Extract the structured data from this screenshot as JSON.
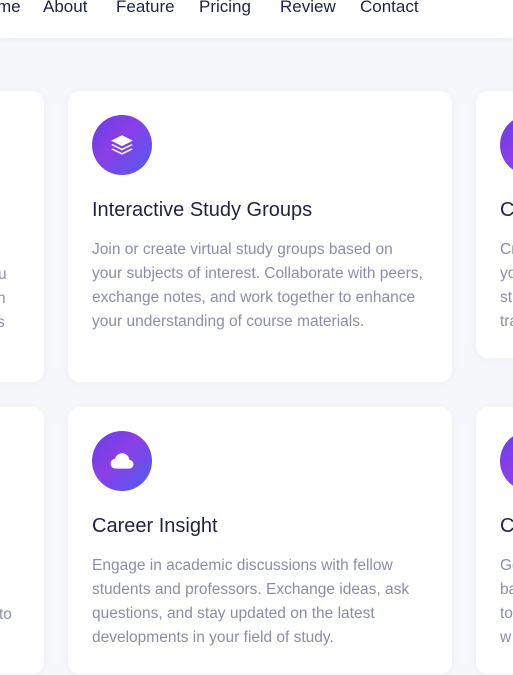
{
  "nav": {
    "items": [
      "me",
      "About",
      "Feature",
      "Pricing",
      "Review",
      "Contact"
    ]
  },
  "colors": {
    "background": "#f6f7fb",
    "card": "#ffffff",
    "title": "#1f2340",
    "body_text": "#8a8fa3",
    "icon_gradient_start": "#6a3de8",
    "icon_gradient_end": "#4a5ef0"
  },
  "cards": {
    "study_groups": {
      "icon": "layers-icon",
      "title": "Interactive Study Groups",
      "description": "Join or create virtual study groups based on your subjects of interest. Collaborate with peers, exchange notes, and work together to enhance your understanding of course materials."
    },
    "career_insight": {
      "icon": "cloud-icon",
      "title": "Career Insight",
      "description": "Engage in academic discussions with fellow students and professors. Exchange ideas, ask questions, and stay updated on the latest developments in your field of study."
    },
    "left_top_fragments": [
      "u",
      "n",
      "s"
    ],
    "left_bottom_fragments": [
      "to"
    ],
    "right_top": {
      "title_fragment": "C",
      "lines": [
        "Cr",
        "yo",
        "st",
        "tra"
      ]
    },
    "right_bottom": {
      "title_fragment": "C",
      "lines": [
        "Ge",
        "ba",
        "to",
        "w"
      ]
    }
  }
}
